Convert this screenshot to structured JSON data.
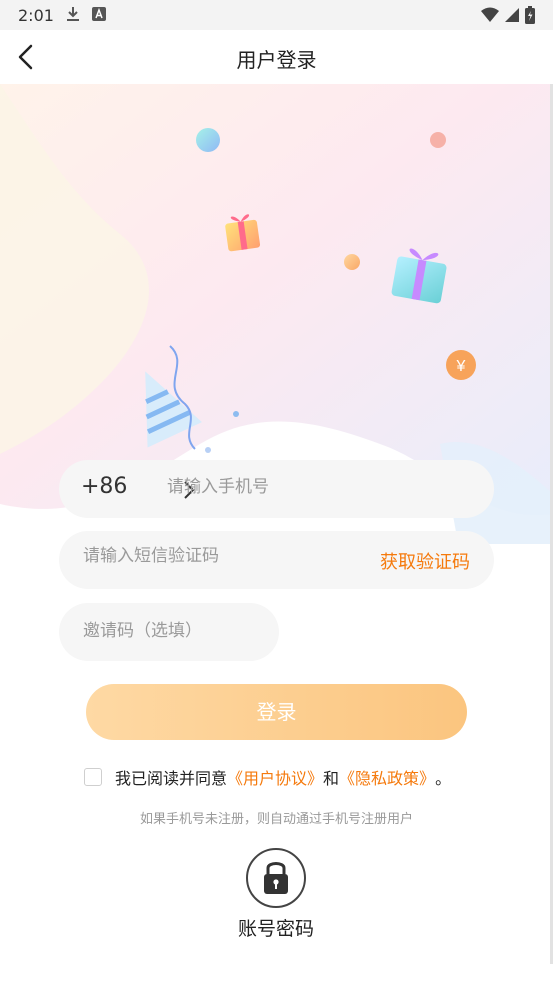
{
  "status_bar": {
    "time": "2:01",
    "left_icons": [
      "download-icon",
      "a-box-icon"
    ],
    "right_icons": [
      "wifi-icon",
      "signal-icon",
      "battery-icon"
    ]
  },
  "nav": {
    "title": "用户登录",
    "back_icon": "back-chevron-icon"
  },
  "form": {
    "country_code": "+86",
    "phone_placeholder": "请输入手机号",
    "sms_placeholder": "请输入短信验证码",
    "get_code_label": "获取验证码",
    "invite_placeholder": "邀请码（选填）",
    "login_label": "登录"
  },
  "agreement": {
    "prefix": "我已阅读并同意",
    "user_agreement": "《用户协议》",
    "and": "和",
    "privacy_policy": "《隐私政策》",
    "suffix": "。",
    "checked": false
  },
  "hint": "如果手机号未注册，则自动通过手机号注册用户",
  "account_login": {
    "label": "账号密码",
    "icon": "lock-icon"
  },
  "colors": {
    "accent": "#f57a0d",
    "login_gradient_start": "#fed9a4",
    "login_gradient_end": "#fbc57f",
    "field_bg": "#f6f6f6"
  }
}
